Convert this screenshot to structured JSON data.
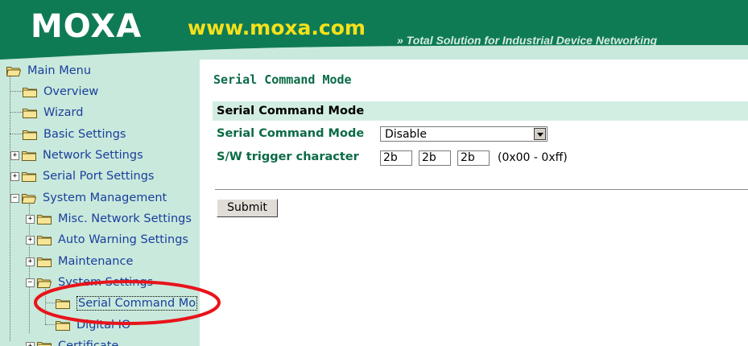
{
  "header": {
    "logo": "MOXA",
    "site": "www.moxa.com",
    "tagline": "» Total Solution for Industrial Device Networking",
    "brand_color": "#0f7b55"
  },
  "sidebar": {
    "items": [
      {
        "label": "Main Menu",
        "icon": "open-folder-icon"
      },
      {
        "label": "Overview",
        "icon": "folder-icon"
      },
      {
        "label": "Wizard",
        "icon": "folder-icon"
      },
      {
        "label": "Basic Settings",
        "icon": "folder-icon"
      },
      {
        "label": "Network Settings",
        "icon": "folder-icon",
        "expander": "+"
      },
      {
        "label": "Serial Port Settings",
        "icon": "folder-icon",
        "expander": "+"
      },
      {
        "label": "System Management",
        "icon": "open-folder-icon",
        "expander": "-"
      },
      {
        "label": "Misc. Network Settings",
        "icon": "folder-icon",
        "expander": "+"
      },
      {
        "label": "Auto Warning Settings",
        "icon": "folder-icon",
        "expander": "+"
      },
      {
        "label": "Maintenance",
        "icon": "folder-icon",
        "expander": "+"
      },
      {
        "label": "System Settings",
        "icon": "open-folder-icon",
        "expander": "-"
      },
      {
        "label": "Serial Command Mo",
        "icon": "folder-icon"
      },
      {
        "label": "Digital IO",
        "icon": "folder-icon"
      },
      {
        "label": "Certificate",
        "icon": "folder-icon",
        "expander": "+"
      }
    ]
  },
  "main": {
    "page_title": "Serial Command Mode",
    "section_title": "Serial Command Mode",
    "fields": {
      "mode_label": "Serial Command Mode",
      "mode_value": "Disable",
      "trigger_label": "S/W trigger character",
      "trigger_values": [
        "2b",
        "2b",
        "2b"
      ],
      "trigger_range": "(0x00 - 0xff)"
    },
    "submit_label": "Submit"
  },
  "annotation": {
    "shape": "ellipse",
    "color": "#e8141b"
  }
}
